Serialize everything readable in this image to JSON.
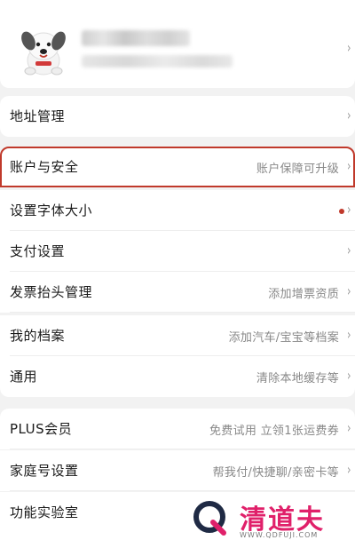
{
  "profile": {
    "name": "",
    "subtitle": ""
  },
  "menu": {
    "group1": [
      {
        "label": "地址管理",
        "value": ""
      }
    ],
    "group2": [
      {
        "label": "账户与安全",
        "value": "账户保障可升级"
      },
      {
        "label": "设置字体大小",
        "value": ""
      },
      {
        "label": "支付设置",
        "value": ""
      },
      {
        "label": "发票抬头管理",
        "value": "添加增票资质"
      },
      {
        "label": "我的档案",
        "value": "添加汽车/宝宝等档案"
      },
      {
        "label": "通用",
        "value": "清除本地缓存等"
      }
    ],
    "group3": [
      {
        "label": "PLUS会员",
        "value": "免费试用 立领1张运费券"
      },
      {
        "label": "家庭号设置",
        "value": "帮我付/快捷聊/亲密卡等"
      },
      {
        "label": "功能实验室",
        "value": ""
      }
    ]
  },
  "icons": {
    "chevron": "›",
    "avatar": "dog-mascot-icon",
    "notification_dot_color": "#c0392b"
  },
  "watermark": {
    "text": "清道夫",
    "url": "WWW.QDFUJI.COM"
  }
}
